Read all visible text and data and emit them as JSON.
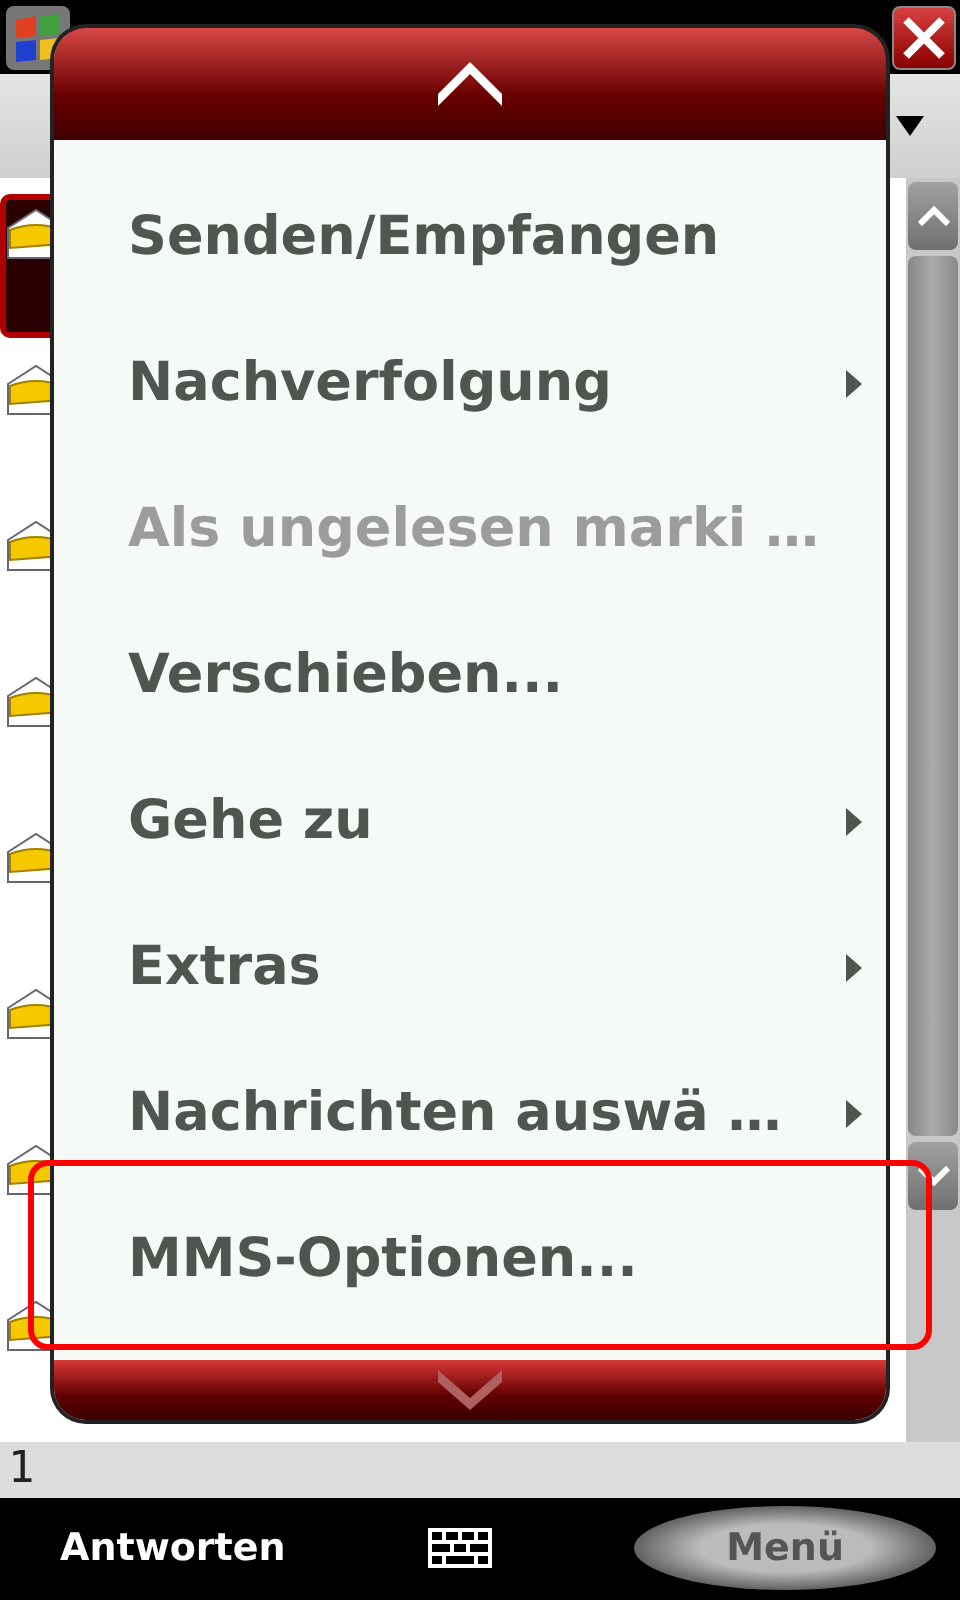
{
  "messages": [
    {
      "selected": true
    },
    {
      "selected": false
    },
    {
      "selected": false
    },
    {
      "selected": false
    },
    {
      "selected": false
    },
    {
      "selected": false
    },
    {
      "selected": false
    },
    {
      "selected": false
    }
  ],
  "status_bar": {
    "text": "1"
  },
  "menu": {
    "items": [
      {
        "label": "Senden/Empfangen",
        "disabled": false,
        "submenu": false,
        "highlighted": false
      },
      {
        "label": "Nachverfolgung",
        "disabled": false,
        "submenu": true,
        "highlighted": false
      },
      {
        "label": "Als ungelesen marki …",
        "disabled": true,
        "submenu": false,
        "highlighted": false
      },
      {
        "label": "Verschieben...",
        "disabled": false,
        "submenu": false,
        "highlighted": false
      },
      {
        "label": "Gehe zu",
        "disabled": false,
        "submenu": true,
        "highlighted": false
      },
      {
        "label": "Extras",
        "disabled": false,
        "submenu": true,
        "highlighted": false
      },
      {
        "label": "Nachrichten auswä …",
        "disabled": false,
        "submenu": true,
        "highlighted": false
      },
      {
        "label": "MMS-Optionen...",
        "disabled": false,
        "submenu": false,
        "highlighted": true
      }
    ]
  },
  "softkeys": [
    {
      "label": "Antworten",
      "pressed": false
    },
    {
      "label": "Menü",
      "pressed": true
    }
  ]
}
